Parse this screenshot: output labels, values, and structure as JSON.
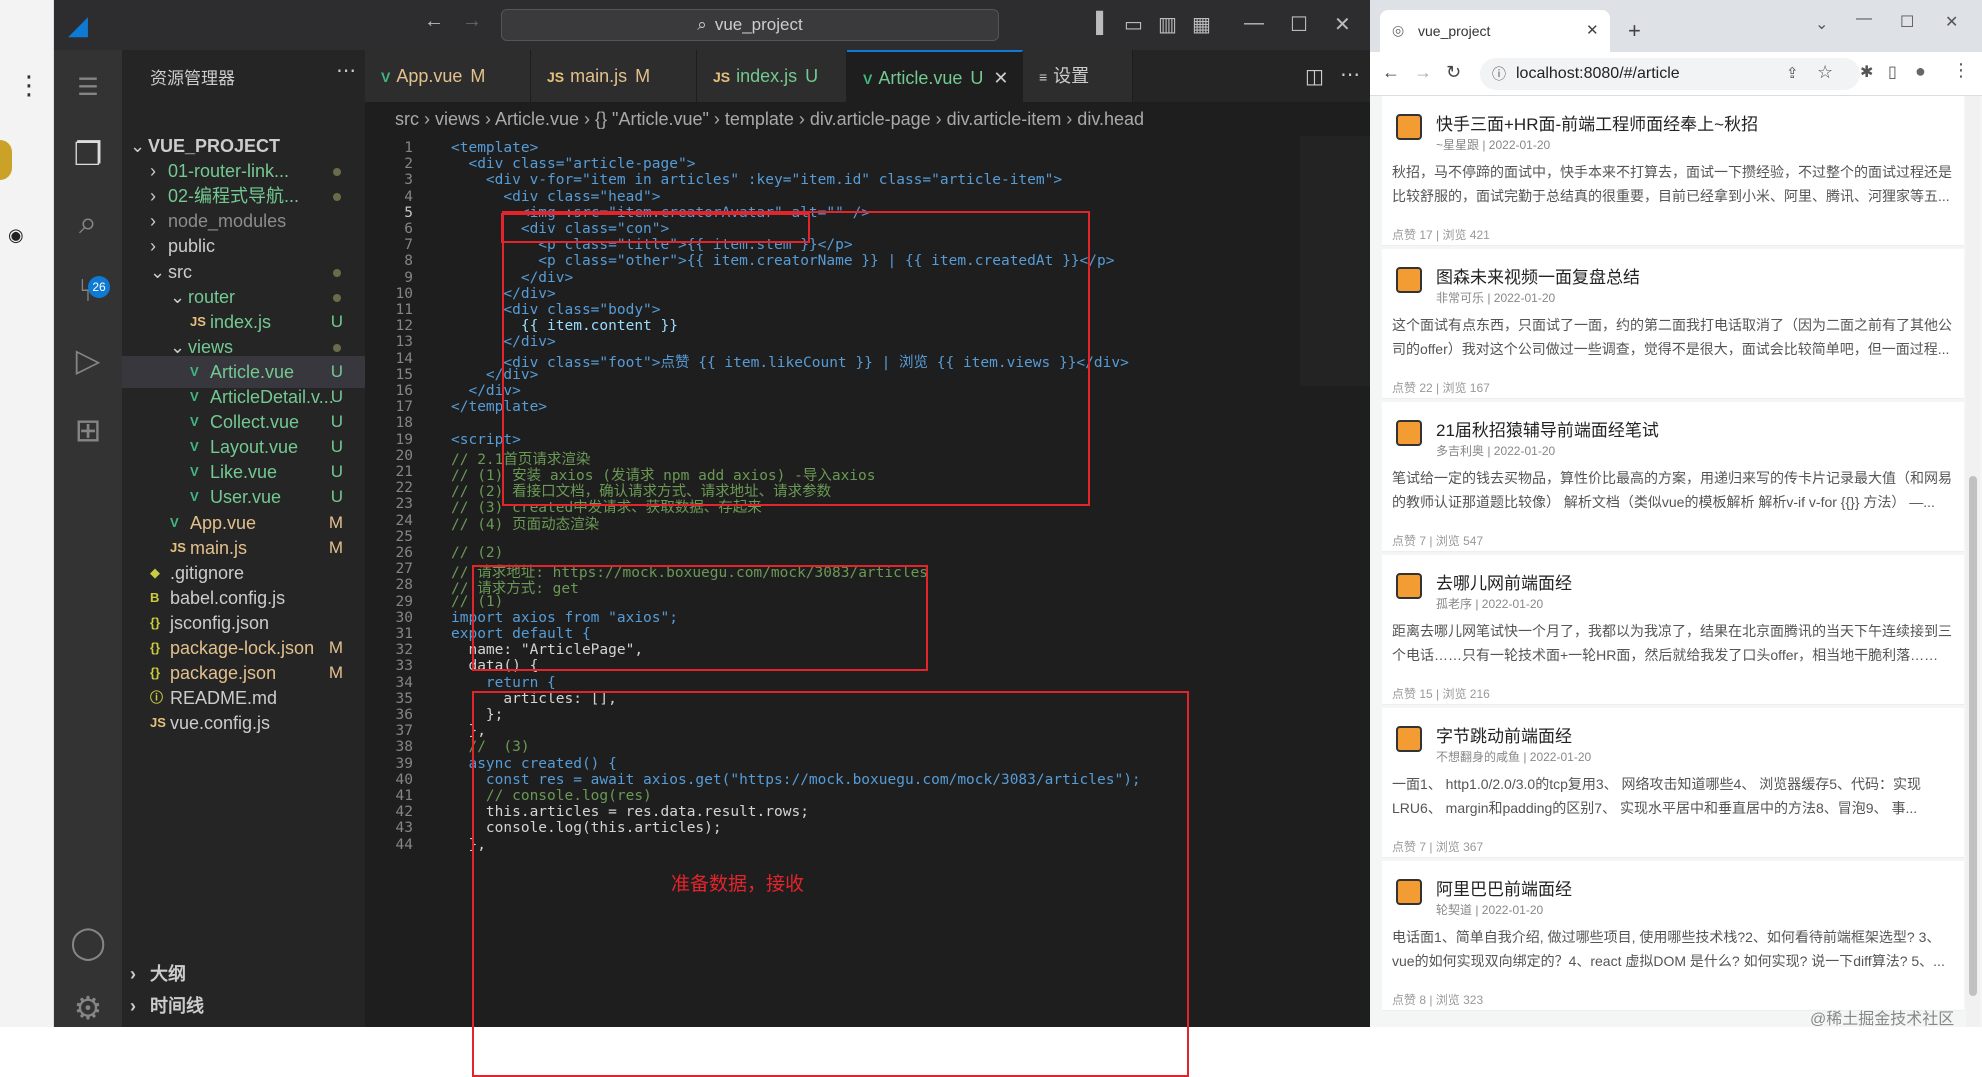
{
  "vscode": {
    "search": "vue_project",
    "sidebar_title": "资源管理器",
    "tree": [
      {
        "name": "VUE_PROJECT",
        "status": "",
        "color": "#ccc"
      },
      {
        "name": "01-router-link...",
        "status": "",
        "color": "#73c991"
      },
      {
        "name": "02-编程式导航...",
        "status": "",
        "color": "#73c991"
      },
      {
        "name": "node_modules",
        "status": "",
        "color": "#8c8c8c"
      },
      {
        "name": "public",
        "status": "",
        "color": "#ccc"
      },
      {
        "name": "src",
        "status": "",
        "color": "#ccc"
      },
      {
        "name": "router",
        "status": "",
        "color": "#73c991"
      },
      {
        "name": "index.js",
        "status": "U",
        "color": "#73c991"
      },
      {
        "name": "views",
        "status": "",
        "color": "#73c991"
      },
      {
        "name": "Article.vue",
        "status": "U",
        "color": "#73c991"
      },
      {
        "name": "ArticleDetail.v...",
        "status": "U",
        "color": "#73c991"
      },
      {
        "name": "Collect.vue",
        "status": "U",
        "color": "#73c991"
      },
      {
        "name": "Layout.vue",
        "status": "U",
        "color": "#73c991"
      },
      {
        "name": "Like.vue",
        "status": "U",
        "color": "#73c991"
      },
      {
        "name": "User.vue",
        "status": "U",
        "color": "#73c991"
      },
      {
        "name": "App.vue",
        "status": "M",
        "color": "#e2c08d"
      },
      {
        "name": "main.js",
        "status": "M",
        "color": "#e2c08d"
      },
      {
        "name": ".gitignore",
        "status": "",
        "color": "#ccc"
      },
      {
        "name": "babel.config.js",
        "status": "",
        "color": "#ccc"
      },
      {
        "name": "jsconfig.json",
        "status": "",
        "color": "#ccc"
      },
      {
        "name": "package-lock.json",
        "status": "M",
        "color": "#e2c08d"
      },
      {
        "name": "package.json",
        "status": "M",
        "color": "#e2c08d"
      },
      {
        "name": "README.md",
        "status": "",
        "color": "#ccc"
      },
      {
        "name": "vue.config.js",
        "status": "",
        "color": "#ccc"
      }
    ],
    "outline": "大纲",
    "timeline": "时间线",
    "scm_badge": "26",
    "tabs": [
      {
        "label": "App.vue",
        "status": "M"
      },
      {
        "label": "main.js",
        "status": "M"
      },
      {
        "label": "index.js",
        "status": "U"
      },
      {
        "label": "Article.vue",
        "status": "U"
      },
      {
        "label": "设置",
        "status": ""
      }
    ],
    "breadcrumb": "src › views › Article.vue › {} \"Article.vue\" › template › div.article-page › div.article-item › div.head",
    "annotation": "准备数据，接收",
    "code": [
      {
        "n": "1",
        "t": "<template>"
      },
      {
        "n": "2",
        "t": "  <div class=\"article-page\">"
      },
      {
        "n": "3",
        "t": "    <div v-for=\"item in articles\" :key=\"item.id\" class=\"article-item\">"
      },
      {
        "n": "4",
        "t": "      <div class=\"head\">"
      },
      {
        "n": "5",
        "t": "        <img :src=\"item.creatorAvatar\" alt=\"\" />"
      },
      {
        "n": "6",
        "t": "        <div class=\"con\">"
      },
      {
        "n": "7",
        "t": "          <p class=\"title\">{{ item.stem }}</p>"
      },
      {
        "n": "8",
        "t": "          <p class=\"other\">{{ item.creatorName }} | {{ item.createdAt }}</p>"
      },
      {
        "n": "9",
        "t": "        </div>"
      },
      {
        "n": "10",
        "t": "      </div>"
      },
      {
        "n": "11",
        "t": "      <div class=\"body\">"
      },
      {
        "n": "12",
        "t": "        {{ item.content }}"
      },
      {
        "n": "13",
        "t": "      </div>"
      },
      {
        "n": "14",
        "t": "      <div class=\"foot\">点赞 {{ item.likeCount }} | 浏览 {{ item.views }}</div>"
      },
      {
        "n": "15",
        "t": "    </div>"
      },
      {
        "n": "16",
        "t": "  </div>"
      },
      {
        "n": "17",
        "t": "</template>"
      },
      {
        "n": "18",
        "t": ""
      },
      {
        "n": "19",
        "t": "<script>"
      },
      {
        "n": "20",
        "t": "// 2.1首页请求渲染"
      },
      {
        "n": "21",
        "t": "// (1) 安装 axios (发请求 npm add axios) -导入axios"
      },
      {
        "n": "22",
        "t": "// (2) 看接口文档，确认请求方式、请求地址、请求参数"
      },
      {
        "n": "23",
        "t": "// (3) created中发请求、获取数据、存起来"
      },
      {
        "n": "24",
        "t": "// (4) 页面动态渲染"
      },
      {
        "n": "25",
        "t": ""
      },
      {
        "n": "26",
        "t": "// (2)"
      },
      {
        "n": "27",
        "t": "// 请求地址: https://mock.boxuegu.com/mock/3083/articles"
      },
      {
        "n": "28",
        "t": "// 请求方式: get"
      },
      {
        "n": "29",
        "t": "// (1)"
      },
      {
        "n": "30",
        "t": "import axios from \"axios\";"
      },
      {
        "n": "31",
        "t": "export default {"
      },
      {
        "n": "32",
        "t": "  name: \"ArticlePage\","
      },
      {
        "n": "33",
        "t": "  data() {"
      },
      {
        "n": "34",
        "t": "    return {"
      },
      {
        "n": "35",
        "t": "      articles: [],"
      },
      {
        "n": "36",
        "t": "    };"
      },
      {
        "n": "37",
        "t": "  },"
      },
      {
        "n": "38",
        "t": "  //  (3)"
      },
      {
        "n": "39",
        "t": "  async created() {"
      },
      {
        "n": "40",
        "t": "    const res = await axios.get(\"https://mock.boxuegu.com/mock/3083/articles\");"
      },
      {
        "n": "41",
        "t": "    // console.log(res)"
      },
      {
        "n": "42",
        "t": "    this.articles = res.data.result.rows;"
      },
      {
        "n": "43",
        "t": "    console.log(this.articles);"
      },
      {
        "n": "44",
        "t": "  },"
      }
    ]
  },
  "browser": {
    "tab_title": "vue_project",
    "url": "localhost:8080/#/article",
    "articles": [
      {
        "title": "快手三面+HR面-前端工程师面经奉上~秋招",
        "other": "~星星跟 | 2022-01-20",
        "body": "秋招，马不停蹄的面试中，快手本来不打算去，面试一下攒经验，不过整个的面试过程还是比较舒服的，面试完勤于总结真的很重要，目前已经拿到小米、阿里、腾讯、河狸家等五...",
        "foot": "点赞 17 | 浏览 421"
      },
      {
        "title": "图森未来视频一面复盘总结",
        "other": "非常可乐 | 2022-01-20",
        "body": "这个面试有点东西，只面试了一面，约的第二面我打电话取消了（因为二面之前有了其他公司的offer）我对这个公司做过一些调查，觉得不是很大，面试会比较简单吧，但一面过程...",
        "foot": "点赞 22 | 浏览 167"
      },
      {
        "title": "21届秋招猿辅导前端面经笔试",
        "other": "多吉利奥 | 2022-01-20",
        "body": "笔试给一定的钱去买物品，算性价比最高的方案，用递归来写的传卡片记录最大值（和网易的教师认证那道题比较像） 解析文档（类似vue的模板解析 解析v-if v-for {{}} 方法） —...",
        "foot": "点赞 7 | 浏览 547"
      },
      {
        "title": "去哪儿网前端面经",
        "other": "孤老序 | 2022-01-20",
        "body": "距离去哪儿网笔试快一个月了，我都以为我凉了，结果在北京面腾讯的当天下午连续接到三个电话……只有一轮技术面+一轮HR面，然后就给我发了口头offer，相当地干脆利落…… ...",
        "foot": "点赞 15 | 浏览 216"
      },
      {
        "title": "字节跳动前端面经",
        "other": "不想翻身的咸鱼 | 2022-01-20",
        "body": "一面1、 http1.0/2.0/3.0的tcp复用3、 网络攻击知道哪些4、 浏览器缓存5、代码：实现LRU6、 margin和padding的区别7、 实现水平居中和垂直居中的方法8、冒泡9、 事...",
        "foot": "点赞 7 | 浏览 367"
      },
      {
        "title": "阿里巴巴前端面经",
        "other": "轮契道 | 2022-01-20",
        "body": "电话面1、简单自我介绍, 做过哪些项目, 使用哪些技术栈?2、如何看待前端框架选型? 3、vue的如何实现双向绑定的？4、react 虚拟DOM 是什么? 如何实现? 说一下diff算法? 5、...",
        "foot": "点赞 8 | 浏览 323"
      }
    ],
    "watermark": "@稀土掘金技术社区"
  },
  "colors": {
    "accent": "#0e7ad3",
    "red": "#e3242b",
    "keyword": "#569cd6",
    "string": "#ce9178",
    "comment": "#6a9955",
    "tag": "#569cd6",
    "attr": "#9cdcfe"
  }
}
